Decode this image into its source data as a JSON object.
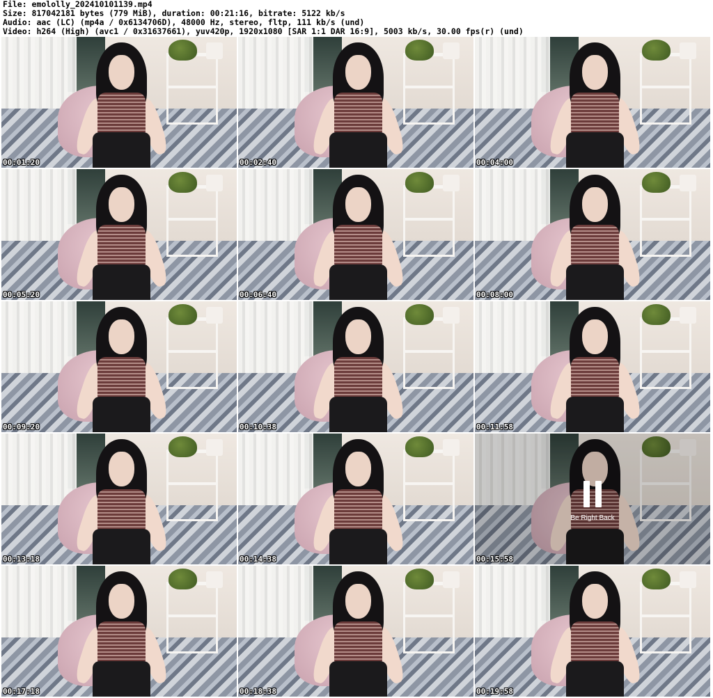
{
  "header": {
    "file_line": "File: emololly_202410101139.mp4",
    "size_line": "Size: 817042181 bytes (779 MiB), duration: 00:21:16, bitrate: 5122 kb/s",
    "audio_line": "Audio: aac (LC) (mp4a / 0x6134706D), 48000 Hz, stereo, fltp, 111 kb/s (und)",
    "video_line": "Video: h264 (High) (avc1 / 0x31637661), yuv420p, 1920x1080 [SAR 1:1 DAR 16:9], 5003 kb/s, 30.00 fps(r) (und)"
  },
  "thumbnails": [
    {
      "timestamp": "00:01:20"
    },
    {
      "timestamp": "00:02:40"
    },
    {
      "timestamp": "00:04:00"
    },
    {
      "timestamp": "00:05:20"
    },
    {
      "timestamp": "00:06:40"
    },
    {
      "timestamp": "00:08:00"
    },
    {
      "timestamp": "00:09:20"
    },
    {
      "timestamp": "00:10:38"
    },
    {
      "timestamp": "00:11:58"
    },
    {
      "timestamp": "00:13:18"
    },
    {
      "timestamp": "00:14:38"
    },
    {
      "timestamp": "00:15:58",
      "overlay_text": "Be Right Back"
    },
    {
      "timestamp": "00:17:18"
    },
    {
      "timestamp": "00:18:38"
    },
    {
      "timestamp": "00:19:58"
    }
  ]
}
